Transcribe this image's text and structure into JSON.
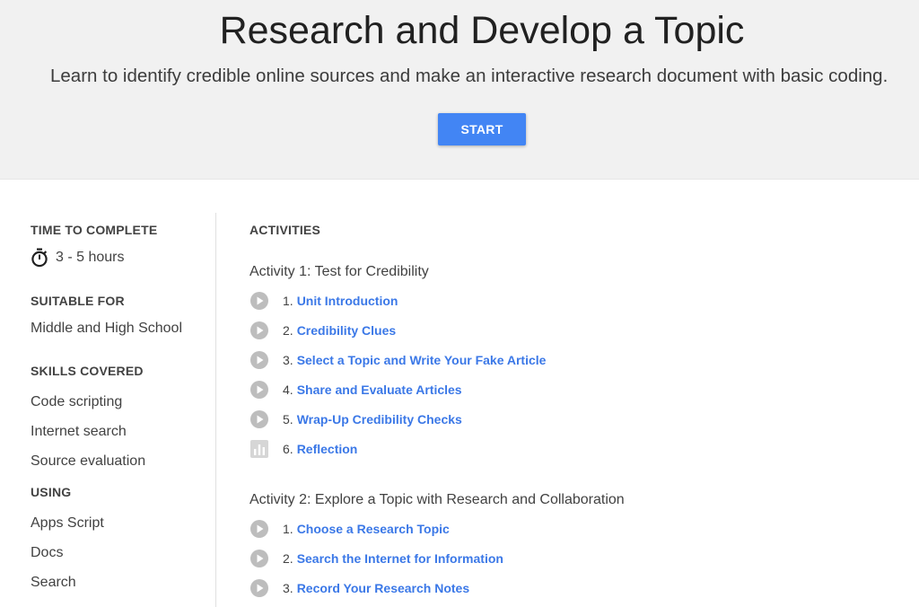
{
  "hero": {
    "title": "Research and Develop a Topic",
    "subtitle": "Learn to identify credible online sources and make an interactive research document with basic coding.",
    "start_label": "START"
  },
  "sidebar": {
    "time_heading": "TIME TO COMPLETE",
    "time_value": "3 - 5 hours",
    "suitable_heading": "SUITABLE FOR",
    "suitable_value": "Middle and High School",
    "skills_heading": "SKILLS COVERED",
    "skills": [
      "Code scripting",
      "Internet search",
      "Source evaluation"
    ],
    "using_heading": "USING",
    "using": [
      "Apps Script",
      "Docs",
      "Search"
    ]
  },
  "main": {
    "activities_heading": "ACTIVITIES",
    "activities": [
      {
        "title": "Activity 1: Test for Credibility",
        "lessons": [
          {
            "num": "1.",
            "label": "Unit Introduction",
            "icon": "play-icon"
          },
          {
            "num": "2.",
            "label": "Credibility Clues",
            "icon": "play-icon"
          },
          {
            "num": "3.",
            "label": "Select a Topic and Write Your Fake Article",
            "icon": "play-icon"
          },
          {
            "num": "4.",
            "label": "Share and Evaluate Articles",
            "icon": "play-icon"
          },
          {
            "num": "5.",
            "label": "Wrap-Up Credibility Checks",
            "icon": "play-icon"
          },
          {
            "num": "6.",
            "label": "Reflection",
            "icon": "bar-chart-icon"
          }
        ]
      },
      {
        "title": "Activity 2: Explore a Topic with Research and Collaboration",
        "lessons": [
          {
            "num": "1.",
            "label": "Choose a Research Topic",
            "icon": "play-icon"
          },
          {
            "num": "2.",
            "label": "Search the Internet for Information",
            "icon": "play-icon"
          },
          {
            "num": "3.",
            "label": "Record Your Research Notes",
            "icon": "play-icon"
          }
        ]
      }
    ]
  },
  "colors": {
    "hero_bg": "#f1f1f1",
    "accent": "#4285f4",
    "link": "#3b78e7",
    "icon_gray": "#bdbdbd"
  }
}
